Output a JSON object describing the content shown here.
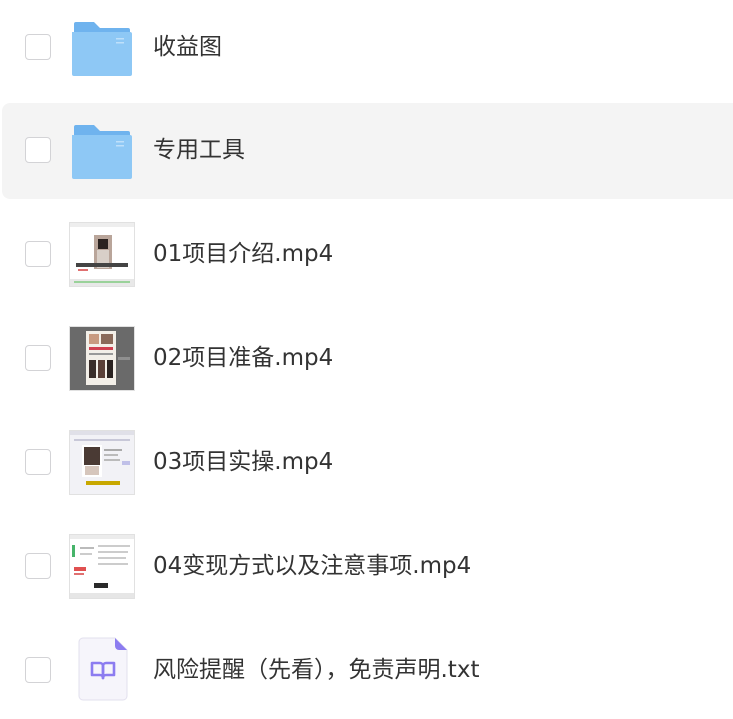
{
  "files": [
    {
      "name": "收益图",
      "type": "folder",
      "icon": "folder-icon"
    },
    {
      "name": "专用工具",
      "type": "folder",
      "icon": "folder-icon"
    },
    {
      "name": "01项目介绍.mp4",
      "type": "video",
      "icon": "video-thumbnail"
    },
    {
      "name": "02项目准备.mp4",
      "type": "video",
      "icon": "video-thumbnail"
    },
    {
      "name": "03项目实操.mp4",
      "type": "video",
      "icon": "video-thumbnail"
    },
    {
      "name": "04变现方式以及注意事项.mp4",
      "type": "video",
      "icon": "video-thumbnail"
    },
    {
      "name": "风险提醒（先看），免责声明.txt",
      "type": "text",
      "icon": "book-icon"
    }
  ],
  "colors": {
    "folder": "#8ec8f5",
    "folder_back": "#6fb3ee",
    "hover_row": "#f4f4f4",
    "text": "#333333",
    "txt_accent": "#8c7cf0"
  }
}
